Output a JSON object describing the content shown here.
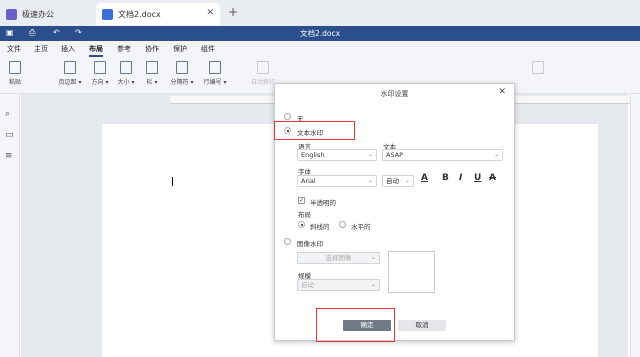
{
  "tabs": [
    {
      "label": "极速办公",
      "icon": "app-logo-icon",
      "color": "#6c5fc7"
    },
    {
      "label": "文档2.docx",
      "icon": "document-icon",
      "color": "#3a6fd8"
    }
  ],
  "title_bar": {
    "doc_title": "文档2.docx"
  },
  "menu": [
    "文件",
    "主页",
    "插入",
    "布局",
    "参考",
    "协作",
    "保护",
    "组件"
  ],
  "active_menu": "布局",
  "ribbon": [
    {
      "label": "粘贴",
      "enabled": true
    },
    {
      "label": "页边距 ▾",
      "enabled": true
    },
    {
      "label": "方向 ▾",
      "enabled": true
    },
    {
      "label": "大小 ▾",
      "enabled": true
    },
    {
      "label": "栏 ▾",
      "enabled": true
    },
    {
      "label": "分隔符 ▾",
      "enabled": true
    },
    {
      "label": "行编号 ▾",
      "enabled": true
    },
    {
      "label": "自动换行",
      "enabled": false
    }
  ],
  "dialog": {
    "title": "水印设置",
    "none_label": "无",
    "text_watermark_label": "文本水印",
    "language_label": "语言",
    "language_value": "English",
    "text_label": "文本",
    "text_value": "ASAP",
    "font_label": "字体",
    "font_value": "Arial",
    "size_value": "自动",
    "font_color_glyph": "A",
    "bold_glyph": "B",
    "italic_glyph": "I",
    "underline_glyph": "U",
    "strike_glyph": "A",
    "semi_transparent_label": "半透明的",
    "layout_label": "布局",
    "diagonal_label": "斜线的",
    "horizontal_label": "水平的",
    "image_watermark_label": "图像水印",
    "select_image_label": "选择图像",
    "scale_label": "规模",
    "scale_value": "自动",
    "ok_label": "确定",
    "cancel_label": "取消"
  },
  "colors": {
    "accent": "#2b4f8c",
    "highlight": "#e53935"
  }
}
